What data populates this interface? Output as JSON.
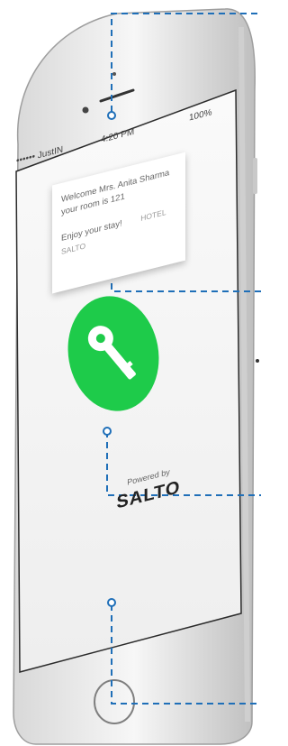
{
  "status_bar": {
    "carrier": "•••••• JustIN",
    "time": "4:20 PM",
    "battery": "100%"
  },
  "notification": {
    "line1": "Welcome Mrs. Anita Sharma",
    "line2": "your room is 121",
    "line3": "Enjoy your stay!",
    "hotel": "HOTEL SALTO"
  },
  "footer": {
    "powered_by": "Powered by",
    "brand": "SALTO"
  },
  "colors": {
    "key_green": "#1ecb4a",
    "callout_blue": "#1f6fb8"
  },
  "icons": {
    "key": "key-icon",
    "home": "home-button-icon"
  }
}
